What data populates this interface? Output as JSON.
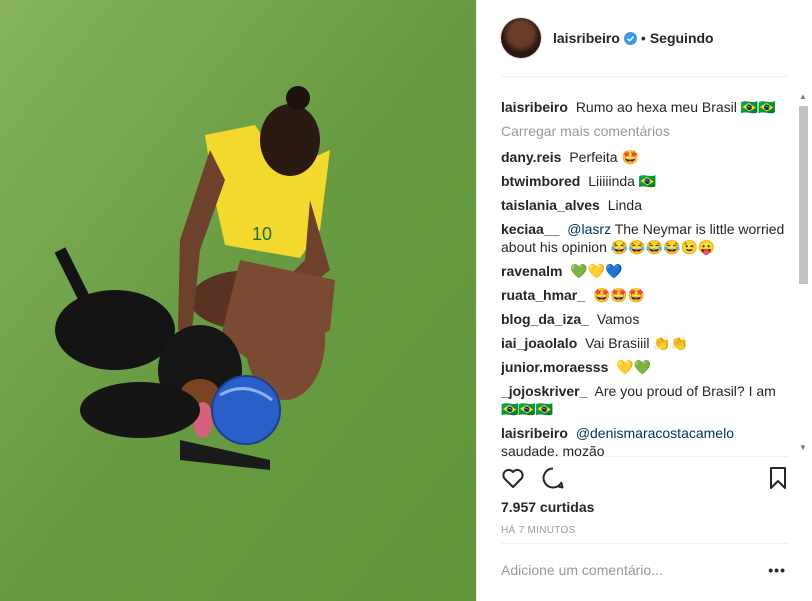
{
  "post": {
    "username": "laisribeiro",
    "follow_status": "Seguindo",
    "dot": "•",
    "caption_user": "laisribeiro",
    "caption_text": "Rumo ao hexa meu Brasil 🇧🇷🇧🇷",
    "load_more": "Carregar mais comentários",
    "likes": "7.957 curtidas",
    "time": "HÁ 7 MINUTOS",
    "add_comment_placeholder": "Adicione um comentário...",
    "more_options": "•••"
  },
  "comments": [
    {
      "user": "dany.reis",
      "text": "Perfeita 🤩"
    },
    {
      "user": "btwimbored",
      "text": "Liiiiinda 🇧🇷"
    },
    {
      "user": "taislania_alves",
      "text": "Linda"
    },
    {
      "user": "keciaa__",
      "mention": "@lasrz",
      "text": "The Neymar is little worried about his opinion 😂😂😂😂😉😛"
    },
    {
      "user": "ravenalm",
      "text": "💚💛💙"
    },
    {
      "user": "ruata_hmar_",
      "text": "🤩🤩🤩"
    },
    {
      "user": "blog_da_iza_",
      "text": "Vamos"
    },
    {
      "user": "iai_joaolalo",
      "text": "Vai Brasiiil 👏👏"
    },
    {
      "user": "junior.moraesss",
      "text": "💛💚"
    },
    {
      "user": "_jojoskriver_",
      "text": "Are you proud of Brasil? I am 🇧🇷🇧🇷🇧🇷"
    },
    {
      "user": "laisribeiro",
      "mention": "@denismaracostacamelo",
      "text": "saudade, mozão"
    }
  ],
  "colors": {
    "link": "#003569",
    "muted": "#999999",
    "verified": "#3897f0"
  }
}
